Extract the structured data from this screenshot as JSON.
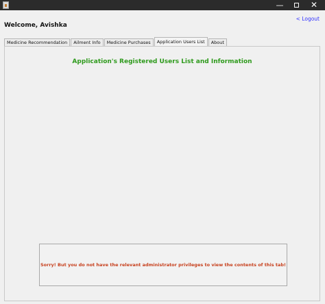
{
  "window": {
    "controls": {
      "minimize": "—",
      "close": "✕"
    }
  },
  "header": {
    "logout_label": "< Logout",
    "welcome_text": "Welcome, Avishka"
  },
  "tabs": [
    {
      "label": "Medicine Recommendation",
      "active": false
    },
    {
      "label": "Ailment Info",
      "active": false
    },
    {
      "label": "Medicine Purchases",
      "active": false
    },
    {
      "label": "Application Users List",
      "active": true
    },
    {
      "label": "About",
      "active": false
    }
  ],
  "main": {
    "heading": "Application's Registered Users List and Information",
    "message": "Sorry! But you do not have the relevant administrator privileges to view the contents of this tab!"
  },
  "colors": {
    "heading": "#2e9a1c",
    "message": "#c7401d",
    "logout_link": "#3333ff",
    "titlebar": "#2b2b2b"
  }
}
